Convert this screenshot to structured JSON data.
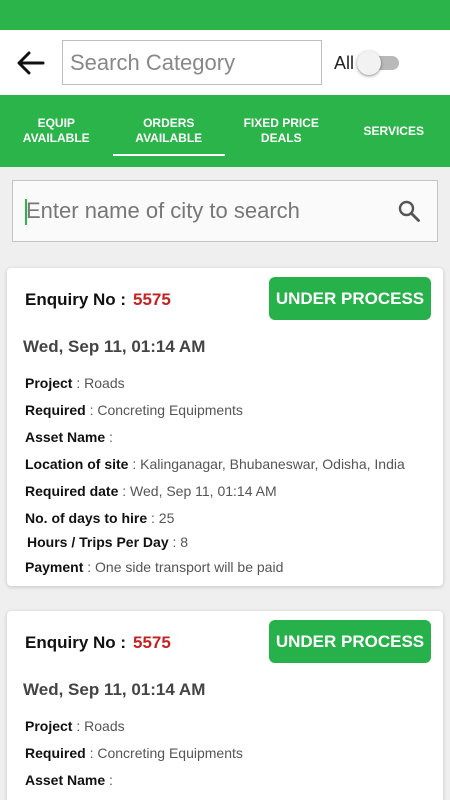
{
  "header": {
    "search_placeholder": "Search Category",
    "all_label": "All",
    "all_toggle_on": false
  },
  "tabs": [
    {
      "line1": "EQUIP",
      "line2": "AVAILABLE",
      "active": false
    },
    {
      "line1": "ORDERS",
      "line2": "AVAILABLE",
      "active": true
    },
    {
      "line1": "FIXED PRICE",
      "line2": "DEALS",
      "active": false
    },
    {
      "line1": "SERVICES",
      "line2": "",
      "active": false
    }
  ],
  "city_search": {
    "placeholder": "Enter name of city to search"
  },
  "labels": {
    "enquiry_no": "Enquiry No :",
    "project": "Project",
    "required": "Required",
    "asset_name": "Asset Name",
    "location": "Location of site",
    "required_date": "Required date",
    "days_to_hire": "No. of days to hire",
    "hours_trips": "Hours / Trips Per Day",
    "payment": "Payment"
  },
  "cards": [
    {
      "enquiry_no": "5575",
      "status": "UNDER PROCESS",
      "date": "Wed, Sep 11, 01:14 AM",
      "project": "Roads",
      "required": "Concreting Equipments",
      "asset_name": "",
      "location": "Kalinganagar, Bhubaneswar, Odisha, India",
      "required_date": "Wed, Sep 11, 01:14 AM",
      "days_to_hire": "25",
      "hours_trips": "8",
      "payment": "One side transport will be paid"
    },
    {
      "enquiry_no": "5575",
      "status": "UNDER PROCESS",
      "date": "Wed, Sep 11, 01:14 AM",
      "project": "Roads",
      "required": "Concreting Equipments",
      "asset_name": ""
    }
  ],
  "colors": {
    "brand_green": "#2bb44a",
    "button_green": "#27b14a",
    "enquiry_red": "#c42323"
  },
  "icons": {
    "back": "arrow-left-icon",
    "search": "magnifier-icon"
  }
}
